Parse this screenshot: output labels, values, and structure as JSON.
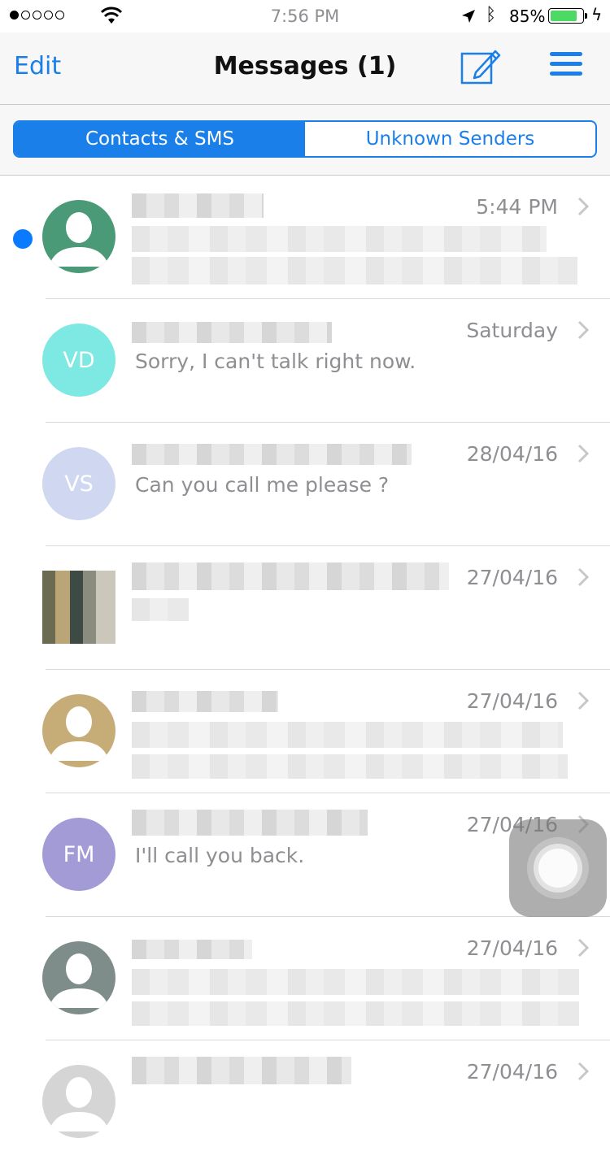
{
  "status": {
    "time": "7:56 PM",
    "battery_percent": "85%",
    "battery_level": 0.85,
    "signal_bars_filled": 1,
    "signal_bars_total": 5
  },
  "nav": {
    "edit_label": "Edit",
    "title": "Messages (1)"
  },
  "tabs": {
    "active": "Contacts & SMS",
    "inactive": "Unknown Senders"
  },
  "conversations": [
    {
      "time": "5:44 PM",
      "avatar": "person-silhouette",
      "avatar_color": "#4a9a78",
      "unread": true,
      "preview": ""
    },
    {
      "time": "Saturday",
      "initials": "VD",
      "avatar_color": "#7ee8e2",
      "preview": "Sorry, I can't talk right now."
    },
    {
      "time": "28/04/16",
      "initials": "VS",
      "avatar_color": "#cfd8f0",
      "preview": "Can you call me please ?"
    },
    {
      "time": "27/04/16",
      "avatar": "photo",
      "preview": ""
    },
    {
      "time": "27/04/16",
      "avatar": "person-silhouette",
      "avatar_color": "#c6ad78",
      "preview": ""
    },
    {
      "time": "27/04/16",
      "initials": "FM",
      "avatar_color": "#a39bd6",
      "preview": "I'll call you back."
    },
    {
      "time": "27/04/16",
      "avatar": "person-silhouette",
      "avatar_color": "#7f8d8a",
      "preview": ""
    },
    {
      "time": "27/04/16",
      "avatar": "person-silhouette",
      "avatar_color": "#d5d5d5",
      "preview": ""
    }
  ],
  "colors": {
    "accent": "#1a7fe8",
    "unread_dot": "#0a7aff",
    "secondary_text": "#8e8e93"
  }
}
